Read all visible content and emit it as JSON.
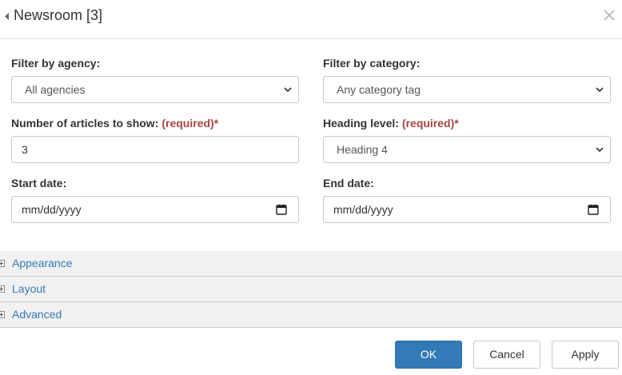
{
  "dialog": {
    "title": "Newsroom [3]"
  },
  "form": {
    "agency": {
      "label": "Filter by agency:",
      "value": "All agencies"
    },
    "category": {
      "label": "Filter by category:",
      "value": "Any category tag"
    },
    "articles": {
      "label": "Number of articles to show:",
      "required": "(required)*",
      "value": "3"
    },
    "heading": {
      "label": "Heading level:",
      "required": "(required)*",
      "value": "Heading 4"
    },
    "start_date": {
      "label": "Start date:",
      "placeholder": "mm/dd/yyyy"
    },
    "end_date": {
      "label": "End date:",
      "placeholder": "mm/dd/yyyy"
    }
  },
  "sections": [
    "Appearance",
    "Layout",
    "Advanced"
  ],
  "buttons": {
    "ok": "OK",
    "cancel": "Cancel",
    "apply": "Apply"
  },
  "icons": {
    "back": "caret-left-icon",
    "close": "close-icon",
    "dropdown": "chevron-down-icon",
    "calendar": "calendar-icon",
    "expand": "plus-square-icon"
  },
  "colors": {
    "accent": "#337ab7",
    "required": "#a94442",
    "section_bg": "#f1f1f1"
  }
}
